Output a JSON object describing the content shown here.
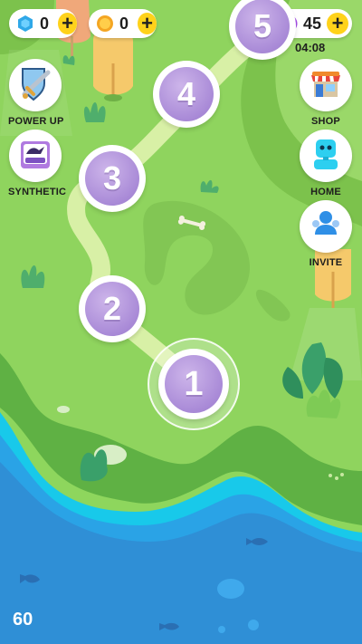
{
  "hud": {
    "gems": {
      "value": "0",
      "icon": "blue-gem-icon"
    },
    "coins": {
      "value": "0",
      "icon": "gold-coin-icon"
    },
    "energy": {
      "value": "45",
      "icon": "lightning-icon",
      "timer": "04:08"
    }
  },
  "side_buttons_left": [
    {
      "label": "POWER UP",
      "icon": "sword-shield-icon"
    },
    {
      "label": "SYNTHETIC",
      "icon": "card-pack-icon"
    }
  ],
  "side_buttons_right": [
    {
      "label": "SHOP",
      "icon": "shop-icon"
    },
    {
      "label": "HOME",
      "icon": "robot-home-icon"
    },
    {
      "label": "INVITE",
      "icon": "invite-friends-icon"
    }
  ],
  "levels": [
    {
      "number": "1",
      "state": "current"
    },
    {
      "number": "2",
      "state": "locked"
    },
    {
      "number": "3",
      "state": "locked"
    },
    {
      "number": "4",
      "state": "locked"
    },
    {
      "number": "5",
      "state": "locked"
    }
  ],
  "fps_counter": "60",
  "colors": {
    "grass": "#8fd45e",
    "path": "#d8f0a6",
    "water": "#2f9be0",
    "level_purple": "#a98ad7",
    "plus_yellow": "#ffd21a"
  }
}
